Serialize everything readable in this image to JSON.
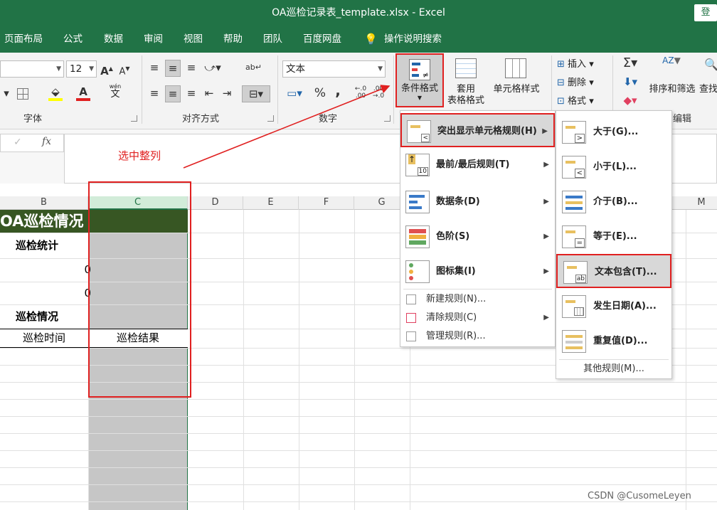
{
  "window": {
    "title": "OA巡检记录表_template.xlsx  -  Excel",
    "login": "登"
  },
  "menu": [
    "页面布局",
    "公式",
    "数据",
    "审阅",
    "视图",
    "帮助",
    "团队",
    "百度网盘",
    "操作说明搜索"
  ],
  "ribbon": {
    "font_size": "12",
    "number_format": "文本",
    "font_group": "字体",
    "align_group": "对齐方式",
    "number_group": "数字",
    "edit_group": "编辑",
    "cond_format": "条件格式",
    "table_format_1": "套用",
    "table_format_2": "表格格式",
    "cell_style": "单元格样式",
    "insert": "插入",
    "delete": "删除",
    "format": "格式",
    "sort_filter": "排序和筛选",
    "find": "查找",
    "wen_glyph": "文",
    "wen_pinyin": "wén",
    "ab_glyph": "ab",
    "percent": "%",
    "comma": ","
  },
  "formula": {
    "cancel": "✓",
    "fx": "fx"
  },
  "annotation": "选中整列",
  "columns": [
    "B",
    "C",
    "D",
    "E",
    "F",
    "G",
    "M"
  ],
  "cells": {
    "title": "OA巡检情况",
    "stats": "巡检统计",
    "zero1": "0",
    "zero2": "0",
    "situation": "巡检情况",
    "time": "巡检时间",
    "result": "巡检结果"
  },
  "cf_menu": {
    "highlight": "突出显示单元格规则(H)",
    "topbottom": "最前/最后规则(T)",
    "databar": "数据条(D)",
    "colorscale": "色阶(S)",
    "iconset": "图标集(I)",
    "newrule": "新建规则(N)...",
    "clearrule": "清除规则(C)",
    "managerule": "管理规则(R)..."
  },
  "sub_menu": {
    "greater": "大于(G)...",
    "less": "小于(L)...",
    "between": "介于(B)...",
    "equal": "等于(E)...",
    "contains": "文本包含(T)...",
    "date": "发生日期(A)...",
    "duplicate": "重复值(D)...",
    "more": "其他规则(M)..."
  },
  "icon_glyphs": {
    "gt": ">",
    "lt": "<",
    "eq": "=",
    "ab": "ab",
    "ne": "≠",
    "ten": "10"
  },
  "watermark": "CSDN @CusomeLeyen",
  "colors": {
    "excel_green": "#217346",
    "title_fill": "#375623",
    "selected_col": "#c6c6c6",
    "annotation_red": "#e02020"
  }
}
